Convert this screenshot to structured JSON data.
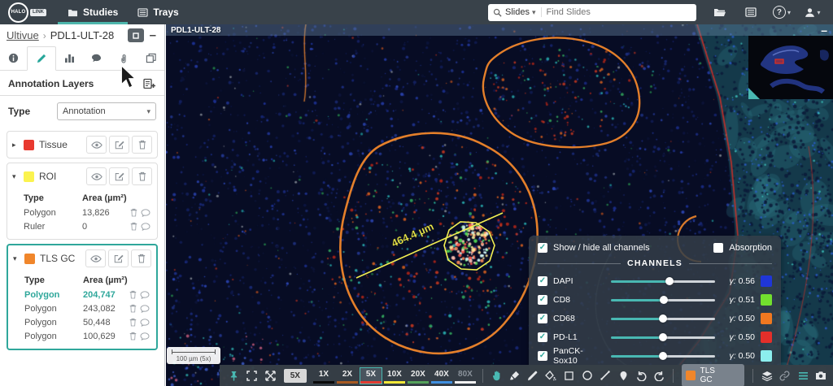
{
  "glyphs": {
    "caret_down": "▾",
    "caret_right": "▸",
    "check": "✓",
    "minus": "–",
    "breadcrumb_sep": "›",
    "question": "?"
  },
  "icons": {
    "topbar": [
      "studies-folder-icon",
      "trays-icon",
      "search-icon",
      "open-folder-icon",
      "tray-grid-icon",
      "help-icon",
      "user-icon"
    ],
    "sidebar_tabs": [
      "info-icon",
      "pencil-icon",
      "chart-icon",
      "comment-icon",
      "attachment-icon",
      "copy-icon"
    ],
    "toolbar": [
      "pin-icon",
      "fullscreen-icon",
      "expand-icon",
      "hand-icon",
      "brush-icon",
      "pen-icon",
      "fill-icon",
      "rectangle-icon",
      "ellipse-icon",
      "line-icon",
      "marker-icon",
      "undo-icon",
      "redo-icon",
      "layers-icon",
      "link-icon",
      "list-icon",
      "camera-icon",
      "gear-icon",
      "share-icon",
      "help-icon"
    ]
  },
  "topbar": {
    "logo": {
      "primary": "HALO",
      "secondary": "LINK"
    },
    "nav": [
      {
        "label": "Studies",
        "active": true
      },
      {
        "label": "Trays",
        "active": false
      }
    ],
    "search": {
      "scope": "Slides",
      "placeholder": "Find Slides"
    }
  },
  "sidebar": {
    "breadcrumb": {
      "parent": "Ultivue",
      "current": "PDL1-ULT-28"
    },
    "section": {
      "title": "Annotation Layers"
    },
    "type_label": "Type",
    "type_value": "Annotation",
    "table": {
      "col_type": "Type",
      "col_area": "Area (µm²)"
    },
    "layers": [
      {
        "name": "Tissue",
        "color": "#e8392f",
        "expanded": false,
        "rows": []
      },
      {
        "name": "ROI",
        "color": "#fbf34f",
        "expanded": true,
        "rows": [
          {
            "type": "Polygon",
            "area": "13,826"
          },
          {
            "type": "Ruler",
            "area": "0"
          }
        ]
      },
      {
        "name": "TLS GC",
        "color": "#f0862b",
        "expanded": true,
        "selected": true,
        "rows": [
          {
            "type": "Polygon",
            "area": "204,747",
            "highlighted": true
          },
          {
            "type": "Polygon",
            "area": "243,082"
          },
          {
            "type": "Polygon",
            "area": "50,448"
          },
          {
            "type": "Polygon",
            "area": "100,629"
          }
        ]
      }
    ]
  },
  "viewer": {
    "slide_label": "PDL1-ULT-28",
    "measurement_label": "464.4 µm",
    "scalebar_label": "100 µm (5x)",
    "annotation_colors": {
      "roi": "#f3ef52",
      "tls_gc": "#f0862b",
      "tissue": "#d23028"
    }
  },
  "channels_panel": {
    "show_hide_label": "Show / hide all channels",
    "absorption_label": "Absorption",
    "header": "CHANNELS",
    "gamma_prefix": "γ:",
    "channels": [
      {
        "name": "DAPI",
        "gamma": "0.56",
        "color": "#1f36d8",
        "level": 56,
        "enabled": true
      },
      {
        "name": "CD8",
        "gamma": "0.51",
        "color": "#72e02e",
        "level": 51,
        "enabled": true
      },
      {
        "name": "CD68",
        "gamma": "0.50",
        "color": "#f07820",
        "level": 50,
        "enabled": true
      },
      {
        "name": "PD-L1",
        "gamma": "0.50",
        "color": "#e42f2a",
        "level": 50,
        "enabled": true
      },
      {
        "name": "PanCK-Sox10",
        "gamma": "0.50",
        "color": "#8ceeee",
        "level": 50,
        "enabled": true
      }
    ]
  },
  "toolbar": {
    "current_zoom": "5X",
    "magnifications": [
      {
        "label": "1X",
        "underline": "#0a0a0a"
      },
      {
        "label": "2X",
        "underline": "#a85a22"
      },
      {
        "label": "5X",
        "underline": "#e23b32",
        "active": true
      },
      {
        "label": "10X",
        "underline": "#f2e838"
      },
      {
        "label": "20X",
        "underline": "#55a25b"
      },
      {
        "label": "40X",
        "underline": "#3f8fe0"
      },
      {
        "label": "80X",
        "underline": "#f2f2f2",
        "disabled": true
      }
    ],
    "layer_select": {
      "label": "TLS GC",
      "color": "#f0862b"
    }
  }
}
